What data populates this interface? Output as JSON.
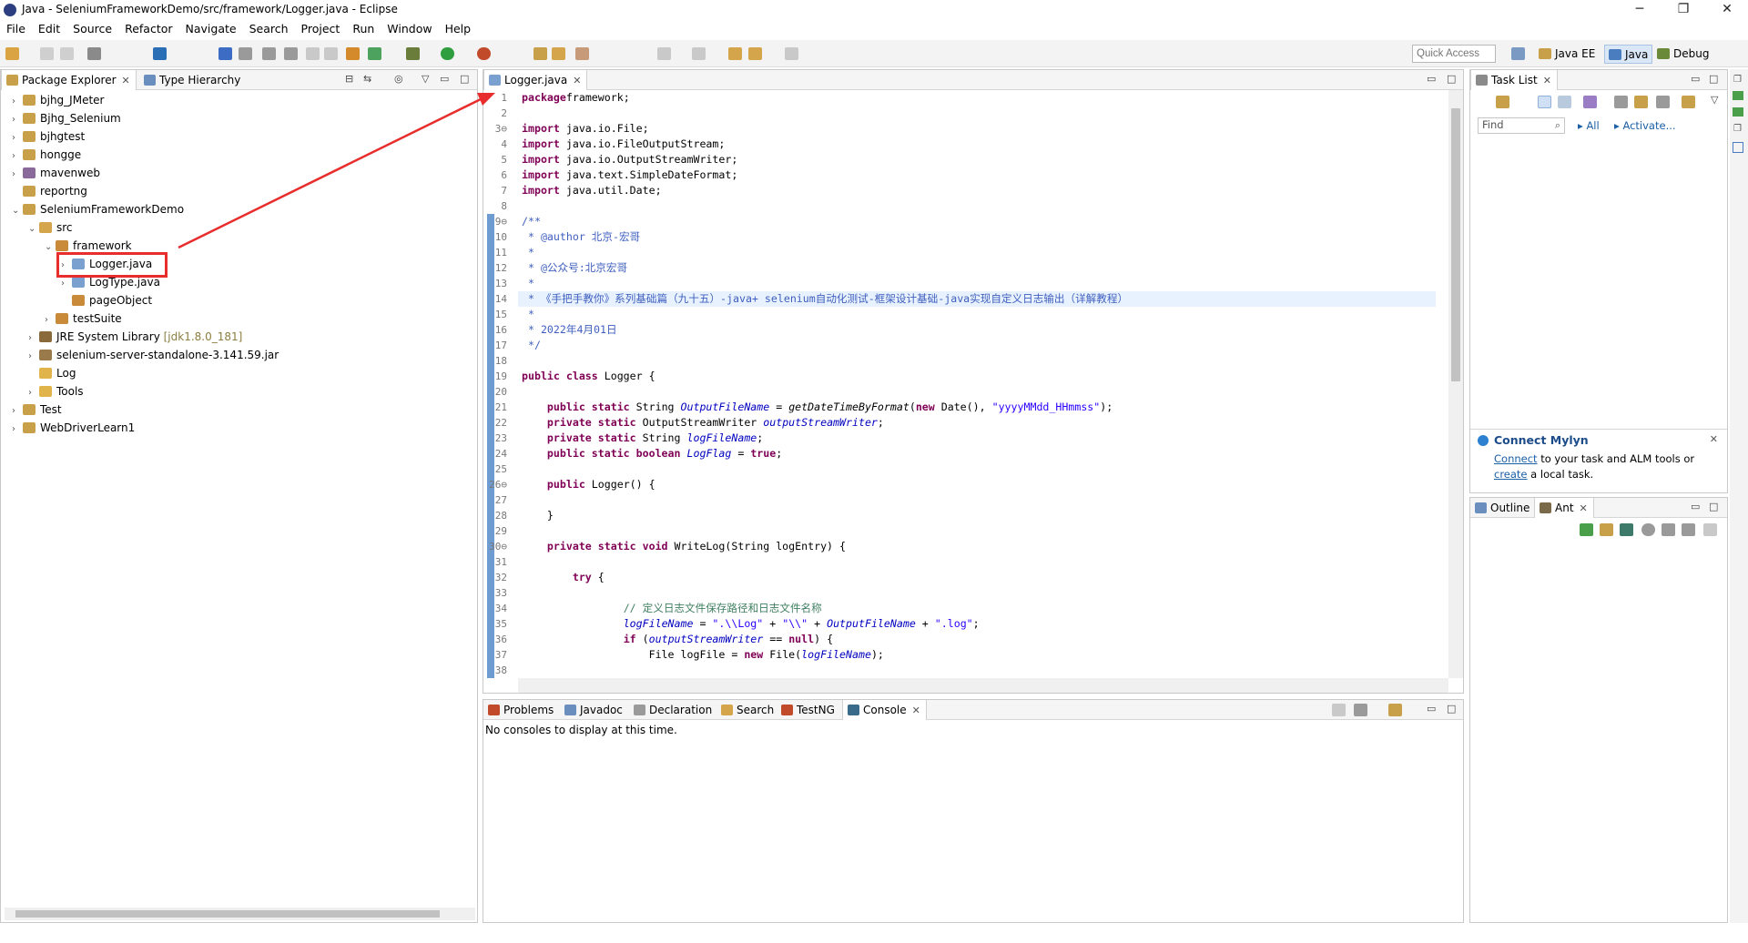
{
  "window": {
    "title": "Java - SeleniumFrameworkDemo/src/framework/Logger.java - Eclipse",
    "min": "─",
    "max": "❐",
    "close": "✕"
  },
  "menu": [
    "File",
    "Edit",
    "Source",
    "Refactor",
    "Navigate",
    "Search",
    "Project",
    "Run",
    "Window",
    "Help"
  ],
  "toolbar": {
    "quick_access": "Quick Access",
    "perspectives": [
      {
        "label": "Java EE"
      },
      {
        "label": "Java"
      },
      {
        "label": "Debug"
      }
    ]
  },
  "explorer": {
    "tabs": [
      "Package Explorer",
      "Type Hierarchy"
    ],
    "items": [
      {
        "label": "bjhg_JMeter",
        "arrow": "›",
        "icon": "project-icon"
      },
      {
        "label": "Bjhg_Selenium",
        "arrow": "›",
        "icon": "project-icon"
      },
      {
        "label": "bjhgtest",
        "arrow": "›",
        "icon": "project-icon"
      },
      {
        "label": "hongge",
        "arrow": "›",
        "icon": "project-icon"
      },
      {
        "label": "mavenweb",
        "arrow": "›",
        "icon": "maven-project-icon"
      },
      {
        "label": "reportng",
        "arrow": "",
        "icon": "project-icon"
      },
      {
        "label": "SeleniumFrameworkDemo",
        "arrow": "⌄",
        "icon": "project-icon"
      },
      {
        "label": "src",
        "arrow": "⌄",
        "icon": "source-folder-icon"
      },
      {
        "label": "framework",
        "arrow": "⌄",
        "icon": "package-icon"
      },
      {
        "label": "Logger.java",
        "arrow": "›",
        "icon": "java-file-icon"
      },
      {
        "label": "LogType.java",
        "arrow": "›",
        "icon": "java-file-icon"
      },
      {
        "label": "pageObject",
        "arrow": "",
        "icon": "package-icon"
      },
      {
        "label": "testSuite",
        "arrow": "›",
        "icon": "package-icon"
      },
      {
        "label": "JRE System Library",
        "extra": "[jdk1.8.0_181]",
        "arrow": "›",
        "icon": "library-icon"
      },
      {
        "label": "selenium-server-standalone-3.141.59.jar",
        "arrow": "›",
        "icon": "jar-icon"
      },
      {
        "label": "Log",
        "arrow": "",
        "icon": "folder-icon"
      },
      {
        "label": "Tools",
        "arrow": "›",
        "icon": "folder-icon"
      },
      {
        "label": "Test",
        "arrow": "›",
        "icon": "project-icon"
      },
      {
        "label": "WebDriverLearn1",
        "arrow": "›",
        "icon": "project-icon"
      }
    ]
  },
  "editor": {
    "tab": "Logger.java",
    "lines": [
      {
        "n": "1",
        "t": [
          [
            "kw",
            "package"
          ],
          [
            "",
            "framework;"
          ]
        ]
      },
      {
        "n": "2",
        "t": []
      },
      {
        "n": "3⊖",
        "t": [
          [
            "kw",
            "import"
          ],
          [
            "",
            " java.io.File;"
          ]
        ]
      },
      {
        "n": "4",
        "t": [
          [
            "kw",
            "import"
          ],
          [
            "",
            " java.io.FileOutputStream;"
          ]
        ]
      },
      {
        "n": "5",
        "t": [
          [
            "kw",
            "import"
          ],
          [
            "",
            " java.io.OutputStreamWriter;"
          ]
        ]
      },
      {
        "n": "6",
        "t": [
          [
            "kw",
            "import"
          ],
          [
            "",
            " java.text.SimpleDateFormat;"
          ]
        ]
      },
      {
        "n": "7",
        "t": [
          [
            "kw",
            "import"
          ],
          [
            "",
            " java.util.Date;"
          ]
        ]
      },
      {
        "n": "8",
        "t": []
      },
      {
        "n": "9⊖",
        "t": [
          [
            "cm",
            "/**"
          ]
        ]
      },
      {
        "n": "10",
        "t": [
          [
            "cm",
            " * @author 北京-宏哥"
          ]
        ]
      },
      {
        "n": "11",
        "t": [
          [
            "cm",
            " *"
          ]
        ]
      },
      {
        "n": "12",
        "t": [
          [
            "cm",
            " * @公众号:北京宏哥"
          ]
        ]
      },
      {
        "n": "13",
        "t": [
          [
            "cm",
            " *"
          ]
        ]
      },
      {
        "n": "14",
        "t": [
          [
            "cm",
            " * 《手把手教你》系列基础篇（九十五）-java+ selenium自动化测试-框架设计基础-java实现自定义日志输出（详解教程）"
          ]
        ]
      },
      {
        "n": "15",
        "t": [
          [
            "cm",
            " *"
          ]
        ]
      },
      {
        "n": "16",
        "t": [
          [
            "cm",
            " * 2022年4月01日"
          ]
        ]
      },
      {
        "n": "17",
        "t": [
          [
            "cm",
            " */"
          ]
        ]
      },
      {
        "n": "18",
        "t": []
      },
      {
        "n": "19",
        "t": [
          [
            "kw",
            "public class"
          ],
          [
            "",
            " Logger {"
          ]
        ]
      },
      {
        "n": "20",
        "t": []
      },
      {
        "n": "21",
        "t": [
          [
            "",
            "    "
          ],
          [
            "kw",
            "public static"
          ],
          [
            "",
            " String "
          ],
          [
            "fld",
            "OutputFileName"
          ],
          [
            "",
            " = "
          ],
          [
            "sm",
            "getDateTimeByFormat"
          ],
          [
            "",
            "("
          ],
          [
            "kw",
            "new"
          ],
          [
            "",
            " Date(), "
          ],
          [
            "str",
            "\"yyyyMMdd_HHmmss\""
          ],
          [
            "",
            ");"
          ]
        ]
      },
      {
        "n": "22",
        "t": [
          [
            "",
            "    "
          ],
          [
            "kw",
            "private static"
          ],
          [
            "",
            " OutputStreamWriter "
          ],
          [
            "fld",
            "outputStreamWriter"
          ],
          [
            "",
            ";"
          ]
        ]
      },
      {
        "n": "23",
        "t": [
          [
            "",
            "    "
          ],
          [
            "kw",
            "private static"
          ],
          [
            "",
            " String "
          ],
          [
            "fld",
            "logFileName"
          ],
          [
            "",
            ";"
          ]
        ]
      },
      {
        "n": "24",
        "t": [
          [
            "",
            "    "
          ],
          [
            "kw",
            "public static boolean"
          ],
          [
            "",
            " "
          ],
          [
            "fld",
            "LogFlag"
          ],
          [
            "",
            " = "
          ],
          [
            "kw",
            "true"
          ],
          [
            "",
            ";"
          ]
        ]
      },
      {
        "n": "25",
        "t": []
      },
      {
        "n": "26⊖",
        "t": [
          [
            "",
            "    "
          ],
          [
            "kw",
            "public"
          ],
          [
            "",
            " Logger() {"
          ]
        ]
      },
      {
        "n": "27",
        "t": []
      },
      {
        "n": "28",
        "t": [
          [
            "",
            "    }"
          ]
        ]
      },
      {
        "n": "29",
        "t": []
      },
      {
        "n": "30⊖",
        "t": [
          [
            "",
            "    "
          ],
          [
            "kw",
            "private static void"
          ],
          [
            "",
            " WriteLog(String logEntry) {"
          ]
        ]
      },
      {
        "n": "31",
        "t": []
      },
      {
        "n": "32",
        "t": [
          [
            "",
            "        "
          ],
          [
            "kw",
            "try"
          ],
          [
            "",
            " {"
          ]
        ]
      },
      {
        "n": "33",
        "t": []
      },
      {
        "n": "34",
        "t": [
          [
            "",
            "                "
          ],
          [
            "cm2",
            "// 定义日志文件保存路径和日志文件名称"
          ]
        ]
      },
      {
        "n": "35",
        "t": [
          [
            "",
            "                "
          ],
          [
            "fld",
            "logFileName"
          ],
          [
            "",
            " = "
          ],
          [
            "str",
            "\".\\\\Log\""
          ],
          [
            "",
            " + "
          ],
          [
            "str",
            "\"\\\\\""
          ],
          [
            "",
            " + "
          ],
          [
            "fld",
            "OutputFileName"
          ],
          [
            "",
            " + "
          ],
          [
            "str",
            "\".log\""
          ],
          [
            "",
            ";"
          ]
        ]
      },
      {
        "n": "36",
        "t": [
          [
            "",
            "                "
          ],
          [
            "kw",
            "if"
          ],
          [
            "",
            " ("
          ],
          [
            "fld",
            "outputStreamWriter"
          ],
          [
            "",
            " == "
          ],
          [
            "kw",
            "null"
          ],
          [
            "",
            ") {"
          ]
        ]
      },
      {
        "n": "37",
        "t": [
          [
            "",
            "                    File logFile = "
          ],
          [
            "kw",
            "new"
          ],
          [
            "",
            " File("
          ],
          [
            "fld",
            "logFileName"
          ],
          [
            "",
            ");"
          ]
        ]
      },
      {
        "n": "38",
        "t": []
      }
    ]
  },
  "tasklist": {
    "tab": "Task List",
    "find_placeholder": "Find",
    "all": "All",
    "activate": "Activate..."
  },
  "mylyn": {
    "title": "Connect Mylyn",
    "connect": "Connect",
    "text1": " to your task and ALM tools or",
    "create": "create",
    "text2": " a local task."
  },
  "outline": {
    "tabs": [
      "Outline",
      "Ant"
    ]
  },
  "bottom": {
    "tabs": [
      "Problems",
      "Javadoc",
      "Declaration",
      "Search",
      "TestNG",
      "Console"
    ],
    "message": "No consoles to display at this time."
  }
}
